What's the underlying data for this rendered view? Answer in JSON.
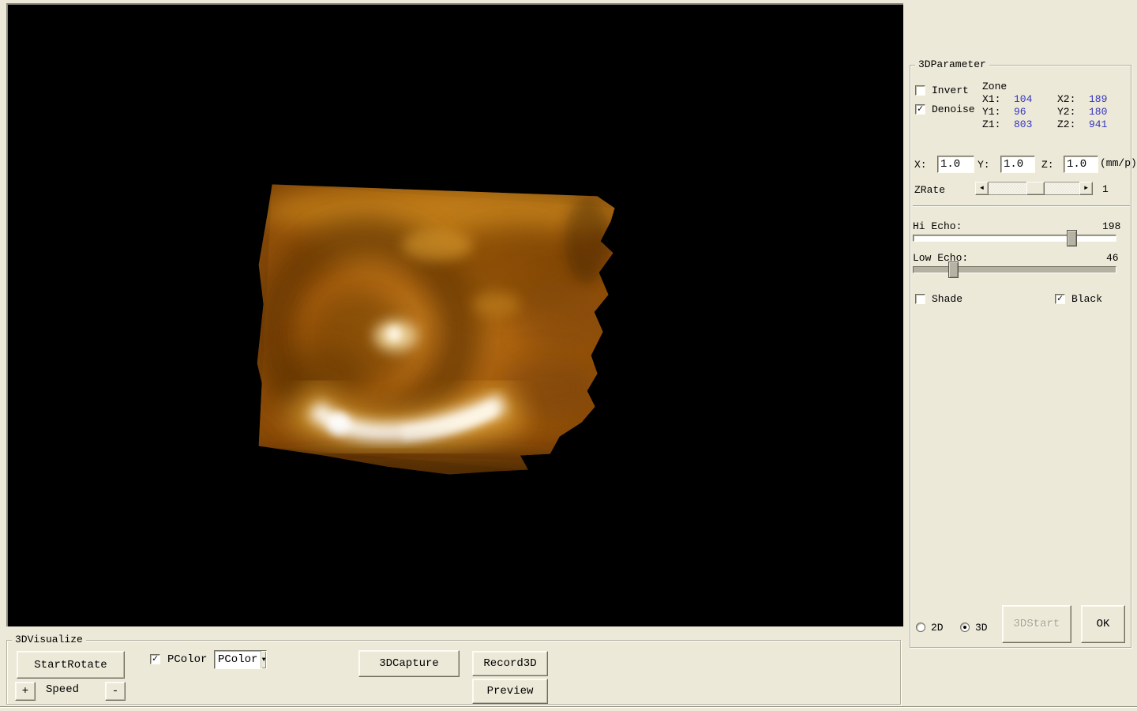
{
  "param_panel": {
    "title": "3DParameter",
    "invert_label": "Invert",
    "denoise_label": "Denoise",
    "zone": {
      "title": "Zone",
      "rows": [
        {
          "l1": "X1:",
          "v1": "104",
          "l2": "X2:",
          "v2": "189"
        },
        {
          "l1": "Y1:",
          "v1": "96",
          "l2": "Y2:",
          "v2": "180"
        },
        {
          "l1": "Z1:",
          "v1": "803",
          "l2": "Z2:",
          "v2": "941"
        }
      ]
    },
    "scale": {
      "x_label": "X:",
      "x_value": "1.0",
      "y_label": "Y:",
      "y_value": "1.0",
      "z_label": "Z:",
      "z_value": "1.0",
      "unit": "(mm/p)"
    },
    "zrate": {
      "label": "ZRate",
      "value": "1"
    },
    "hi_echo": {
      "label": "Hi Echo:",
      "value": "198"
    },
    "low_echo": {
      "label": "Low Echo:",
      "value": "46"
    },
    "shade_label": "Shade",
    "black_label": "Black",
    "radio_2d_label": "2D",
    "radio_3d_label": "3D",
    "start3d_label": "3DStart",
    "ok_label": "OK"
  },
  "visualize_panel": {
    "title": "3DVisualize",
    "start_rotate_label": "StartRotate",
    "pcolor_label": "PColor",
    "pcolor_selected": "PColor",
    "speed_plus_label": "+",
    "speed_label": "Speed",
    "speed_minus_label": "-",
    "capture_label": "3DCapture",
    "record_label": "Record3D",
    "preview_label": "Preview"
  },
  "icons": {
    "check": "✓",
    "dropdown_arrow": "▼",
    "arrow_left": "◄",
    "arrow_right": "►"
  },
  "colors": {
    "panel_bg": "#ece9d8",
    "value_blue": "#3434c0",
    "viewport_bg": "#000000",
    "volume_base": "#a9600e",
    "volume_dark": "#5e3305",
    "volume_bright": "#c9871f",
    "volume_highlight": "#fff8e8"
  }
}
